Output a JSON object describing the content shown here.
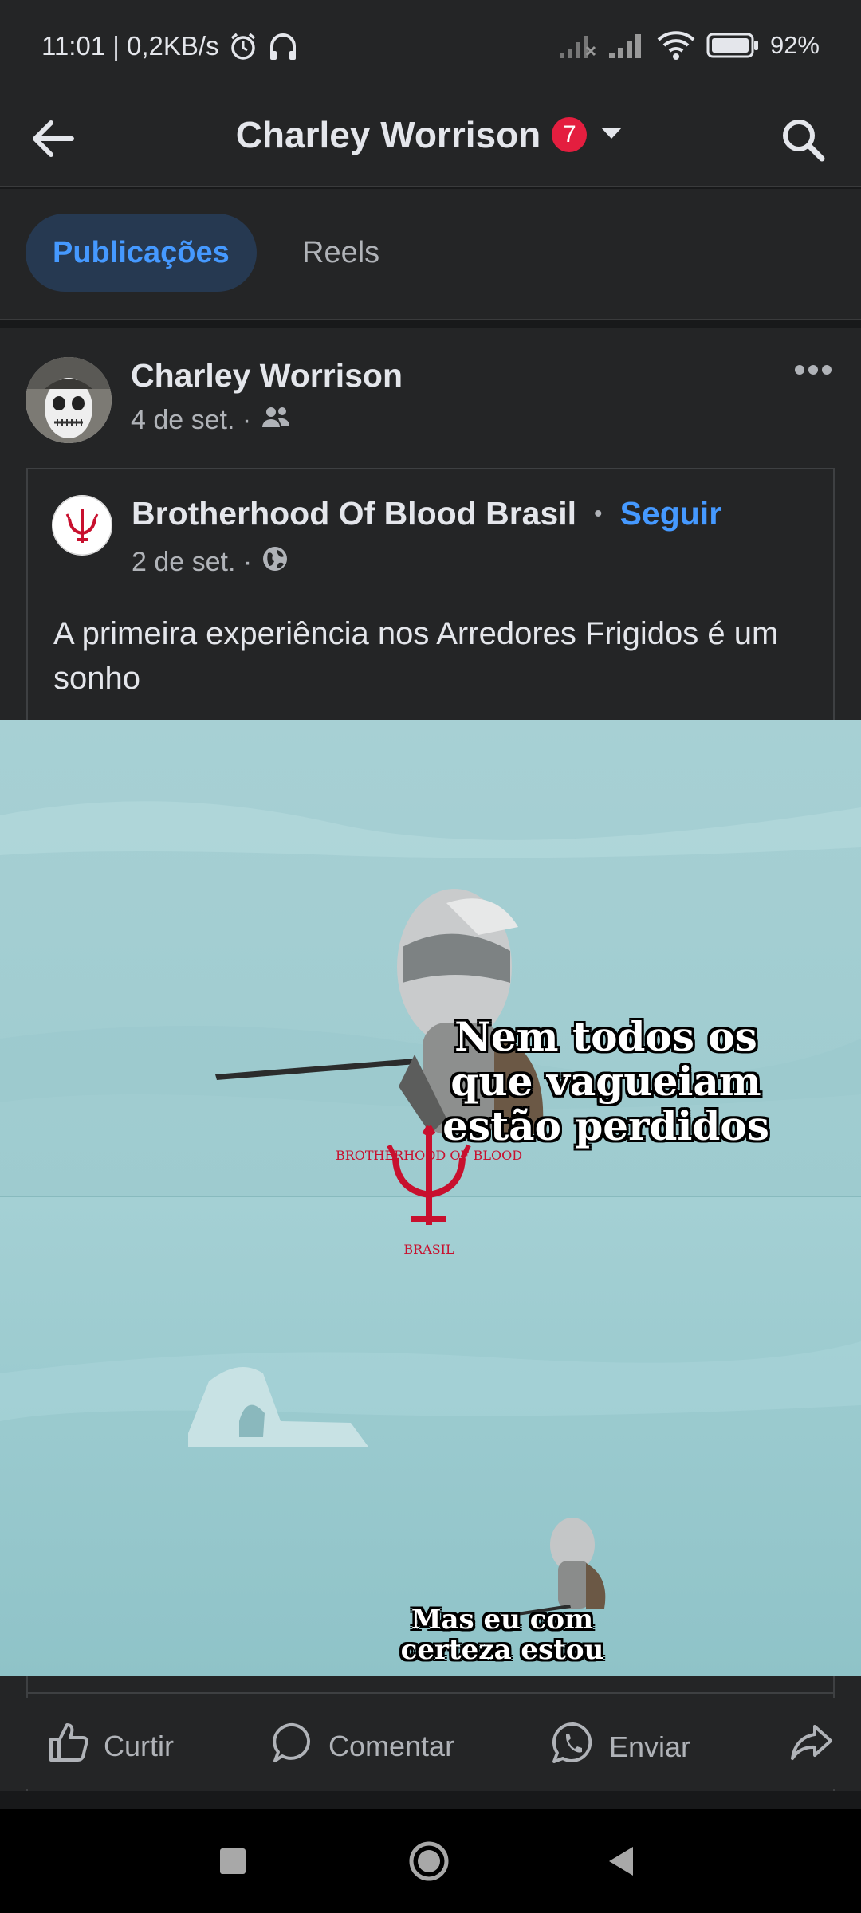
{
  "status_bar": {
    "time_speed": "11:01 | 0,2KB/s",
    "battery": "92%",
    "icons": [
      "alarm-icon",
      "headphones-icon",
      "signal-off-icon",
      "signal-icon",
      "wifi-icon",
      "battery-icon"
    ]
  },
  "app_bar": {
    "back_icon": "arrow-left-icon",
    "title": "Charley Worrison",
    "badge": "7",
    "dropdown_icon": "caret-down-icon",
    "search_icon": "search-icon"
  },
  "tabs": [
    {
      "label": "Publicações",
      "active": true
    },
    {
      "label": "Reels",
      "active": false
    }
  ],
  "post": {
    "author": "Charley Worrison",
    "date": "4 de set. ·",
    "audience_icon": "friends-icon",
    "more_icon": "more-icon",
    "shared": {
      "page_name": "Brotherhood Of Blood Brasil",
      "separator": "•",
      "follow_label": "Seguir",
      "date": "2 de set. ·",
      "audience_icon": "globe-icon",
      "text": "A primeira experiência nos Arredores Frigidos é um sonho",
      "meme": {
        "top_caption": "Nem todos os que vagueiam estão perdidos",
        "bottom_caption": "Mas eu com certeza estou",
        "watermark_arc": "BROTHERHOOD OF BLOOD",
        "watermark_sub": "BRASIL"
      }
    }
  },
  "actions": [
    {
      "label": "Curtir",
      "icon": "thumbs-up-icon"
    },
    {
      "label": "Comentar",
      "icon": "comment-icon"
    },
    {
      "label": "Enviar",
      "icon": "whatsapp-icon"
    },
    {
      "label": "",
      "icon": "share-icon"
    }
  ],
  "colors": {
    "background": "#18191a",
    "surface": "#242526",
    "accent": "#4599ff",
    "badge": "#e41e3f",
    "meme_sky": "#a9d2d6"
  }
}
